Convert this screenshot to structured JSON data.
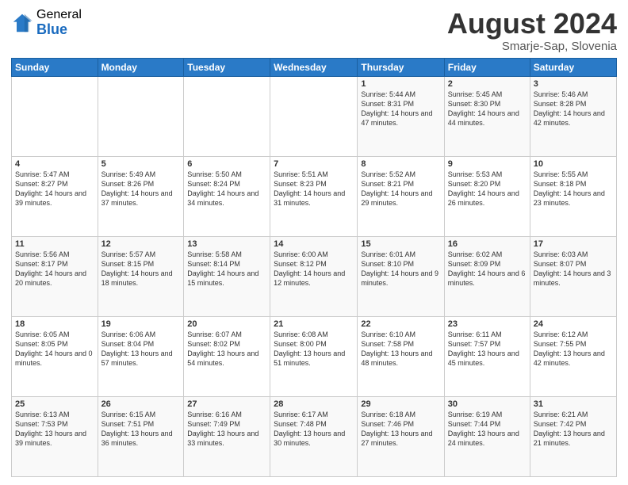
{
  "logo": {
    "general": "General",
    "blue": "Blue"
  },
  "header": {
    "month_title": "August 2024",
    "subtitle": "Smarje-Sap, Slovenia"
  },
  "days_of_week": [
    "Sunday",
    "Monday",
    "Tuesday",
    "Wednesday",
    "Thursday",
    "Friday",
    "Saturday"
  ],
  "weeks": [
    [
      {
        "day": "",
        "info": ""
      },
      {
        "day": "",
        "info": ""
      },
      {
        "day": "",
        "info": ""
      },
      {
        "day": "",
        "info": ""
      },
      {
        "day": "1",
        "info": "Sunrise: 5:44 AM\nSunset: 8:31 PM\nDaylight: 14 hours and 47 minutes."
      },
      {
        "day": "2",
        "info": "Sunrise: 5:45 AM\nSunset: 8:30 PM\nDaylight: 14 hours and 44 minutes."
      },
      {
        "day": "3",
        "info": "Sunrise: 5:46 AM\nSunset: 8:28 PM\nDaylight: 14 hours and 42 minutes."
      }
    ],
    [
      {
        "day": "4",
        "info": "Sunrise: 5:47 AM\nSunset: 8:27 PM\nDaylight: 14 hours and 39 minutes."
      },
      {
        "day": "5",
        "info": "Sunrise: 5:49 AM\nSunset: 8:26 PM\nDaylight: 14 hours and 37 minutes."
      },
      {
        "day": "6",
        "info": "Sunrise: 5:50 AM\nSunset: 8:24 PM\nDaylight: 14 hours and 34 minutes."
      },
      {
        "day": "7",
        "info": "Sunrise: 5:51 AM\nSunset: 8:23 PM\nDaylight: 14 hours and 31 minutes."
      },
      {
        "day": "8",
        "info": "Sunrise: 5:52 AM\nSunset: 8:21 PM\nDaylight: 14 hours and 29 minutes."
      },
      {
        "day": "9",
        "info": "Sunrise: 5:53 AM\nSunset: 8:20 PM\nDaylight: 14 hours and 26 minutes."
      },
      {
        "day": "10",
        "info": "Sunrise: 5:55 AM\nSunset: 8:18 PM\nDaylight: 14 hours and 23 minutes."
      }
    ],
    [
      {
        "day": "11",
        "info": "Sunrise: 5:56 AM\nSunset: 8:17 PM\nDaylight: 14 hours and 20 minutes."
      },
      {
        "day": "12",
        "info": "Sunrise: 5:57 AM\nSunset: 8:15 PM\nDaylight: 14 hours and 18 minutes."
      },
      {
        "day": "13",
        "info": "Sunrise: 5:58 AM\nSunset: 8:14 PM\nDaylight: 14 hours and 15 minutes."
      },
      {
        "day": "14",
        "info": "Sunrise: 6:00 AM\nSunset: 8:12 PM\nDaylight: 14 hours and 12 minutes."
      },
      {
        "day": "15",
        "info": "Sunrise: 6:01 AM\nSunset: 8:10 PM\nDaylight: 14 hours and 9 minutes."
      },
      {
        "day": "16",
        "info": "Sunrise: 6:02 AM\nSunset: 8:09 PM\nDaylight: 14 hours and 6 minutes."
      },
      {
        "day": "17",
        "info": "Sunrise: 6:03 AM\nSunset: 8:07 PM\nDaylight: 14 hours and 3 minutes."
      }
    ],
    [
      {
        "day": "18",
        "info": "Sunrise: 6:05 AM\nSunset: 8:05 PM\nDaylight: 14 hours and 0 minutes."
      },
      {
        "day": "19",
        "info": "Sunrise: 6:06 AM\nSunset: 8:04 PM\nDaylight: 13 hours and 57 minutes."
      },
      {
        "day": "20",
        "info": "Sunrise: 6:07 AM\nSunset: 8:02 PM\nDaylight: 13 hours and 54 minutes."
      },
      {
        "day": "21",
        "info": "Sunrise: 6:08 AM\nSunset: 8:00 PM\nDaylight: 13 hours and 51 minutes."
      },
      {
        "day": "22",
        "info": "Sunrise: 6:10 AM\nSunset: 7:58 PM\nDaylight: 13 hours and 48 minutes."
      },
      {
        "day": "23",
        "info": "Sunrise: 6:11 AM\nSunset: 7:57 PM\nDaylight: 13 hours and 45 minutes."
      },
      {
        "day": "24",
        "info": "Sunrise: 6:12 AM\nSunset: 7:55 PM\nDaylight: 13 hours and 42 minutes."
      }
    ],
    [
      {
        "day": "25",
        "info": "Sunrise: 6:13 AM\nSunset: 7:53 PM\nDaylight: 13 hours and 39 minutes."
      },
      {
        "day": "26",
        "info": "Sunrise: 6:15 AM\nSunset: 7:51 PM\nDaylight: 13 hours and 36 minutes."
      },
      {
        "day": "27",
        "info": "Sunrise: 6:16 AM\nSunset: 7:49 PM\nDaylight: 13 hours and 33 minutes."
      },
      {
        "day": "28",
        "info": "Sunrise: 6:17 AM\nSunset: 7:48 PM\nDaylight: 13 hours and 30 minutes."
      },
      {
        "day": "29",
        "info": "Sunrise: 6:18 AM\nSunset: 7:46 PM\nDaylight: 13 hours and 27 minutes."
      },
      {
        "day": "30",
        "info": "Sunrise: 6:19 AM\nSunset: 7:44 PM\nDaylight: 13 hours and 24 minutes."
      },
      {
        "day": "31",
        "info": "Sunrise: 6:21 AM\nSunset: 7:42 PM\nDaylight: 13 hours and 21 minutes."
      }
    ]
  ]
}
